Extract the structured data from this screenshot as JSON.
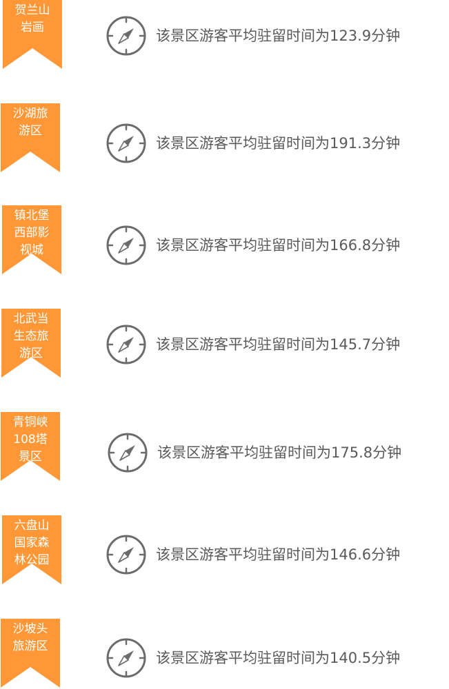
{
  "colors": {
    "ribbon": "#FF9736",
    "text": "#595959",
    "icon": "#6b6b6b"
  },
  "icon": "compass-icon",
  "items": [
    {
      "name": "贺兰山\n岩画",
      "text": "该景区游客平均驻留时间为123.9分钟"
    },
    {
      "name": "沙湖旅\n游区",
      "text": "该景区游客平均驻留时间为191.3分钟"
    },
    {
      "name": "镇北堡\n西部影\n视城",
      "text": "该景区游客平均驻留时间为166.8分钟"
    },
    {
      "name": "北武当\n生态旅\n游区",
      "text": "该景区游客平均驻留时间为145.7分钟"
    },
    {
      "name": "青铜峡\n108塔\n景区",
      "text": "该景区游客平均驻留时间为175.8分钟"
    },
    {
      "name": "六盘山\n国家森\n林公园",
      "text": "该景区游客平均驻留时间为146.6分钟"
    },
    {
      "name": "沙坡头\n旅游区",
      "text": "该景区游客平均驻留时间为140.5分钟"
    }
  ]
}
